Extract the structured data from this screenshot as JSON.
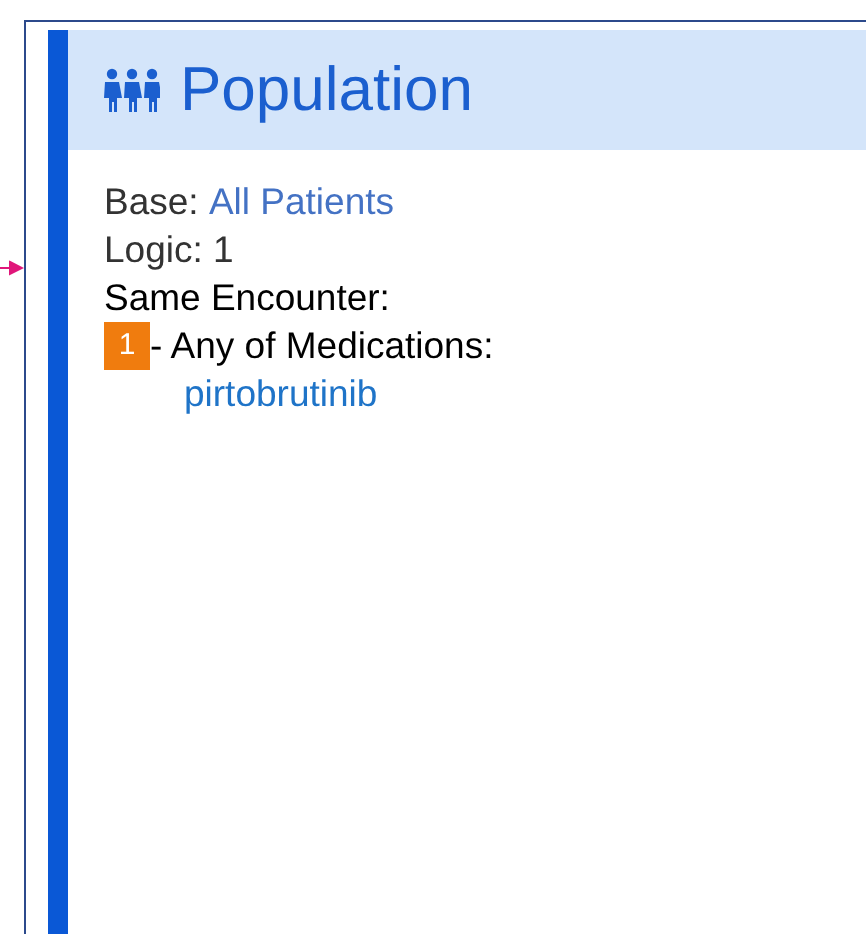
{
  "panel": {
    "title": "Population",
    "base": {
      "label": "Base:",
      "value": "All Patients"
    },
    "logic": "Logic: 1",
    "group_label": "Same Encounter:",
    "criteria": [
      {
        "number": "1",
        "label": "- Any of Medications:",
        "items": [
          "pirtobrutinib"
        ]
      }
    ]
  }
}
